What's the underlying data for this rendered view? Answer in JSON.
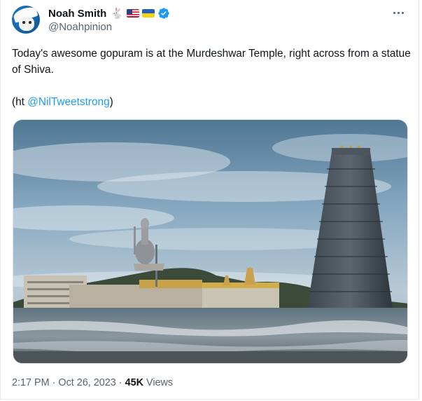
{
  "author": {
    "display_name": "Noah Smith",
    "handle": "@Noahpinion",
    "badges": [
      "rabbit-icon",
      "us-flag-icon",
      "ukraine-flag-icon",
      "verified-badge-icon"
    ],
    "avatar_icon": "avatar"
  },
  "tweet": {
    "text_line1": "Today's awesome gopuram is at the Murdeshwar Temple, right across from a statue of Shiva.",
    "ht_prefix": "(ht ",
    "ht_mention": "@NilTweetstrong",
    "ht_suffix": ")"
  },
  "meta": {
    "time": "2:17 PM",
    "separator1": "·",
    "date": "Oct 26, 2023",
    "separator2": "·",
    "views_count": "45K",
    "views_label": "Views"
  },
  "colors": {
    "link": "#1d9bf0",
    "secondary_text": "#536471",
    "primary_text": "#0f1419"
  }
}
